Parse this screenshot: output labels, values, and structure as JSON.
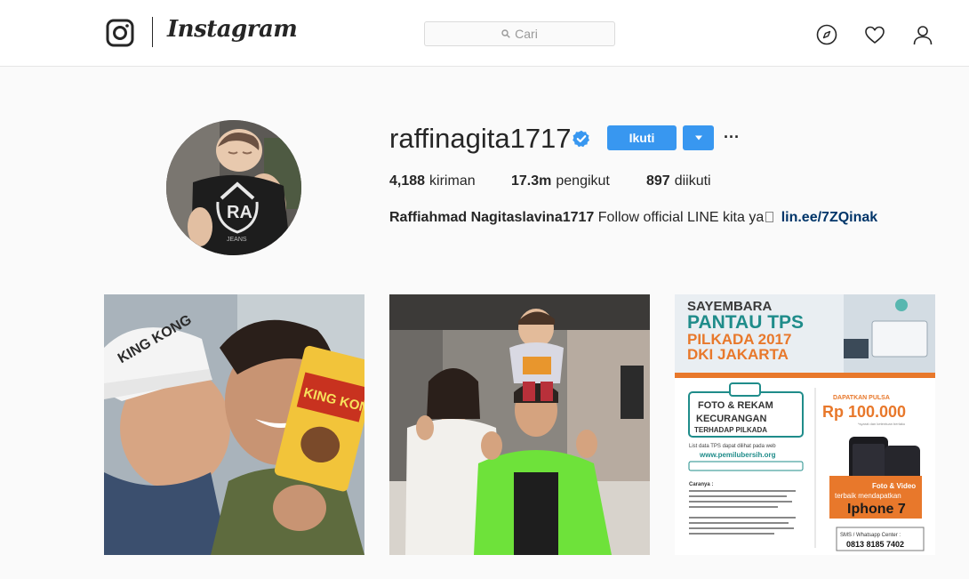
{
  "header": {
    "wordmark": "Instagram",
    "search_placeholder": "Cari"
  },
  "profile": {
    "username": "raffinagita1717",
    "follow_label": "Ikuti",
    "more_label": "···",
    "stats": [
      {
        "value": "4,188",
        "label": "kiriman"
      },
      {
        "value": "17.3m",
        "label": "pengikut"
      },
      {
        "value": "897",
        "label": "diikuti"
      }
    ],
    "bio": {
      "full_name": "Raffiahmad Nagitaslavina1717",
      "text": "Follow official LINE kita ya",
      "link": "lin.ee/7ZQinak"
    },
    "avatar_shirt_text": "JEANS"
  },
  "posts": [
    {
      "cap_text": "KING KONG",
      "snack_text": "KING KONG"
    },
    {},
    {
      "title_small": "SAYEMBARA",
      "title_1": "PANTAU TPS",
      "title_2": "PILKADA 2017",
      "title_3": "DKI JAKARTA",
      "camera_heading_1": "FOTO & REKAM",
      "camera_heading_2": "KECURANGAN",
      "camera_heading_3": "TERHADAP PILKADA",
      "tps_note": "List data TPS dapat dilihat pada web",
      "tps_url": "www.pemilubersih.org",
      "prize_label": "DAPATKAN PULSA",
      "prize_amount": "Rp 100.000",
      "prize_note": "*syarat dan ketentuan berlaku",
      "best_line_1": "Foto & Video",
      "best_line_2": "terbaik mendapatkan",
      "best_prize": "Iphone 7",
      "sms_label": "SMS / Whatsapp Center :",
      "sms_number": "0813 8185 7402",
      "steps_heading": "Caranya :"
    }
  ],
  "colors": {
    "accent": "#3897f0",
    "link": "#003569",
    "border": "#dbdbdb",
    "poster_orange": "#e8782b",
    "poster_teal": "#1f8c8a"
  }
}
